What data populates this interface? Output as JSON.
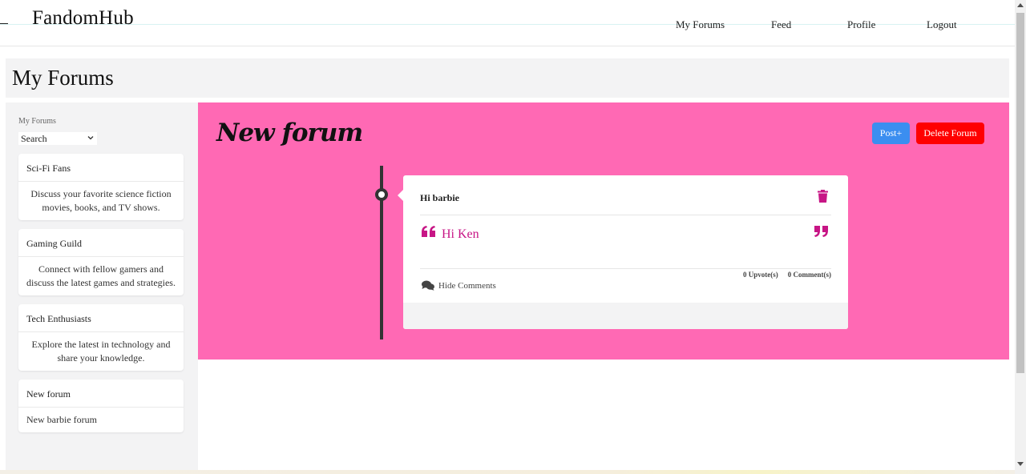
{
  "header": {
    "brand": "FandomHub",
    "nav": [
      "My Forums",
      "Feed",
      "Profile",
      "Logout"
    ]
  },
  "page": {
    "title": "My Forums"
  },
  "sidebar": {
    "label": "My Forums",
    "select_value": "Search",
    "forums": [
      {
        "title": "Sci-Fi Fans",
        "description": "Discuss your favorite science fiction movies, books, and TV shows."
      },
      {
        "title": "Gaming Guild",
        "description": "Connect with fellow gamers and discuss the latest games and strategies."
      },
      {
        "title": "Tech Enthusiasts",
        "description": "Explore the latest in technology and share your knowledge."
      },
      {
        "title": "New forum",
        "description": "New barbie forum"
      }
    ]
  },
  "forum": {
    "title": "New forum",
    "post_button": "Post+",
    "delete_button": "Delete Forum",
    "posts": [
      {
        "title": "Hi barbie",
        "body": "Hi Ken",
        "upvotes": "0 Upvote(s)",
        "comments": "0 Comment(s)",
        "toggle_label": "Hide Comments"
      }
    ]
  },
  "colors": {
    "panel_bg": "#ff69b4",
    "accent_text": "#c71585",
    "post_button": "#3b8ef0",
    "delete_button": "#ff0000",
    "sidebar_bg": "#f3f3f4"
  },
  "icons": [
    "trash-icon",
    "quote-left-icon",
    "quote-right-icon",
    "comments-icon",
    "chevron-down-icon"
  ]
}
